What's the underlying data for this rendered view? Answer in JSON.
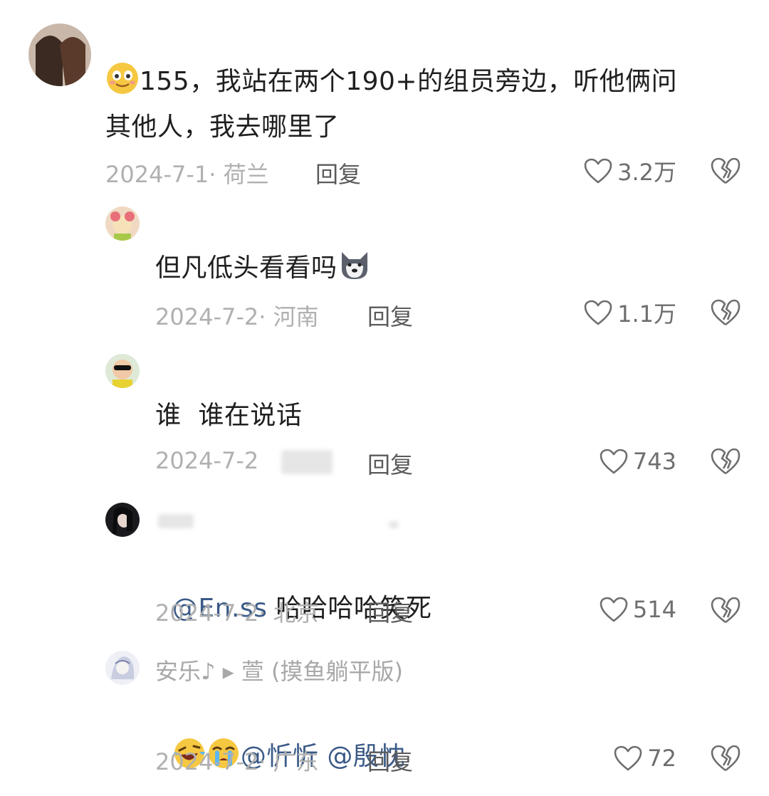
{
  "comments": [
    {
      "text": "155，我站在两个190+的组员旁边，听他俩问",
      "text2": "其他人，我去哪里了",
      "date": "2024-7-1",
      "location": "荷兰",
      "reply": "回复",
      "likes": "3.2万",
      "emoji": "smiling-face-icon"
    },
    {
      "text": "但凡低头看看吗",
      "date": "2024-7-2",
      "location": "河南",
      "reply": "回复",
      "likes": "1.1万",
      "emoji": "husky-dog-icon"
    },
    {
      "text": "谁  谁在说话",
      "date": "2024-7-2",
      "reply": "回复",
      "likes": "743"
    },
    {
      "mention": "@En.ss",
      "text": " 哈哈哈哈笑死",
      "date": "2024-7-2",
      "location": "北京",
      "reply": "回复",
      "likes": "514"
    },
    {
      "username": "安乐♪ ▸ 萱 (摸鱼躺平版)",
      "mention1": "@忻忻",
      "mention2": "@殷忱",
      "date": "2024-7-2",
      "location": "广东",
      "reply": "回复",
      "likes": "72",
      "emojis": [
        "laughing-crying-face-icon",
        "loudly-crying-face-icon"
      ]
    }
  ],
  "colors": {
    "text": "#1f1f1f",
    "meta": "#b0b0b0",
    "mention": "#3a5a87",
    "icon": "#6e6e6e"
  }
}
